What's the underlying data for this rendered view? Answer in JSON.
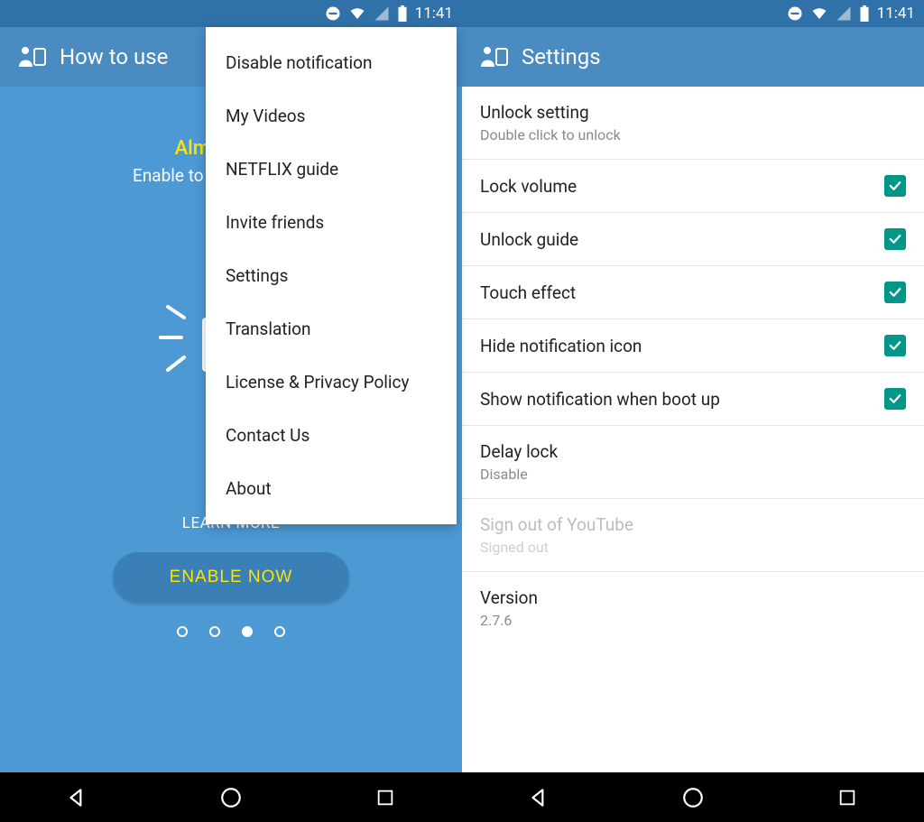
{
  "status": {
    "time": "11:41"
  },
  "left": {
    "appbar_title": "How to use",
    "hero_title": "Almost done",
    "hero_sub": "Enable to lock touch input",
    "learn_more": "LEARN MORE",
    "enable_btn": "ENABLE NOW",
    "menu": [
      "Disable notification",
      "My Videos",
      "NETFLIX guide",
      "Invite friends",
      "Settings",
      "Translation",
      "License & Privacy Policy",
      "Contact Us",
      "About"
    ]
  },
  "right": {
    "appbar_title": "Settings",
    "rows": {
      "unlock_setting": {
        "title": "Unlock setting",
        "sub": "Double click to unlock"
      },
      "lock_volume": {
        "title": "Lock volume"
      },
      "unlock_guide": {
        "title": "Unlock guide"
      },
      "touch_effect": {
        "title": "Touch effect"
      },
      "hide_notif_icon": {
        "title": "Hide notification icon"
      },
      "show_notif_boot": {
        "title": "Show notification when boot up"
      },
      "delay_lock": {
        "title": "Delay lock",
        "sub": "Disable"
      },
      "sign_out_youtube": {
        "title": "Sign out of YouTube",
        "sub": "Signed out"
      },
      "version": {
        "title": "Version",
        "sub": "2.7.6"
      }
    }
  }
}
